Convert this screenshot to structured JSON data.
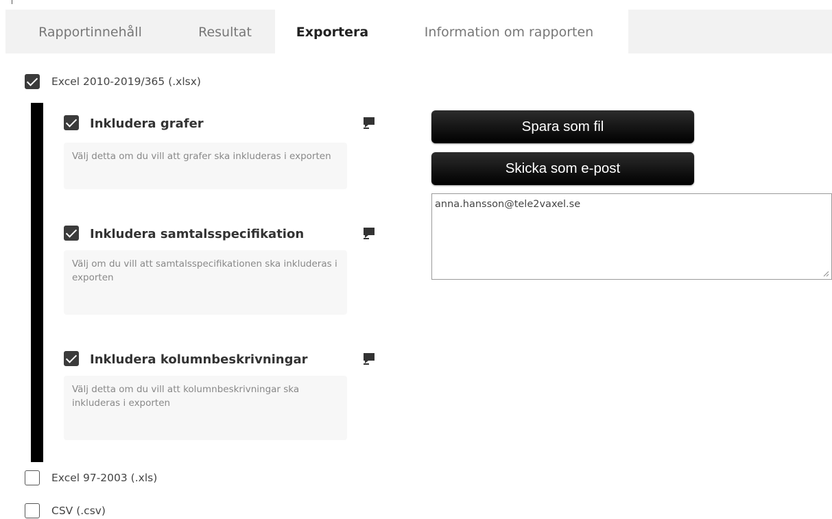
{
  "tabs": [
    {
      "label": "Rapportinnehåll",
      "active": false
    },
    {
      "label": "Resultat",
      "active": false
    },
    {
      "label": "Exportera",
      "active": true
    },
    {
      "label": "Information om rapporten",
      "active": false
    }
  ],
  "formats": {
    "xlsx": {
      "label": "Excel 2010-2019/365 (.xlsx)",
      "checked": true
    },
    "xls": {
      "label": "Excel 97-2003 (.xls)",
      "checked": false
    },
    "csv": {
      "label": "CSV (.csv)",
      "checked": false
    }
  },
  "options": [
    {
      "label": "Inkludera grafer",
      "checked": true,
      "description": "Välj detta om du vill att grafer ska inkluderas i exporten",
      "icon": "comment-icon"
    },
    {
      "label": "Inkludera samtalsspecifikation",
      "checked": true,
      "description": "Välj om du vill att samtalsspecifikationen ska inkluderas i exporten",
      "icon": "comment-icon"
    },
    {
      "label": "Inkludera kolumnbeskrivningar",
      "checked": true,
      "description": "Välj detta om du vill att kolumnbeskrivningar ska inkluderas i exporten",
      "icon": "comment-icon"
    }
  ],
  "actions": {
    "save_label": "Spara som fil",
    "email_label": "Skicka som e-post",
    "email_value": "anna.hansson@tele2vaxel.se"
  },
  "colors": {
    "button_bg": "#000000",
    "accent_bar": "#000000",
    "tab_bg": "#f2f2f2"
  }
}
